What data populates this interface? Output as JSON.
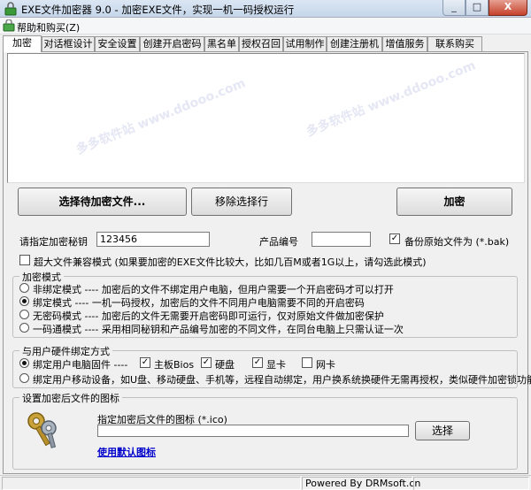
{
  "window": {
    "title": "EXE文件加密器 9.0 - 加密EXE文件，实现一机一码授权运行",
    "minimize": "_",
    "maximize": "□",
    "close": "X"
  },
  "menu": {
    "help_purchase": "帮助和购买(Z)"
  },
  "tabs": [
    "加密",
    "对话框设计",
    "安全设置",
    "创建开启密码",
    "黑名单",
    "授权召回",
    "试用制作",
    "创建注册机",
    "增值服务",
    "联系购买"
  ],
  "watermark": "多多软件站 www.ddooo.com",
  "buttons": {
    "select_files": "选择待加密文件...",
    "remove_selected": "移除选择行",
    "encrypt": "加密",
    "browse_icon": "选择"
  },
  "form": {
    "secret_key_label": "请指定加密秘钥",
    "secret_key_value": "123456",
    "product_code_label": "产品编号",
    "product_code_value": "",
    "backup_label": "备份原始文件为 (*.bak)",
    "backup_checked": true,
    "large_file_label": "超大文件兼容模式 (如果要加密的EXE文件比较大，比如几百M或者1G以上，请勾选此模式)",
    "large_file_checked": false
  },
  "encryption_mode": {
    "title": "加密模式",
    "options": [
      {
        "label": "非绑定模式 ---- 加密后的文件不绑定用户电脑，但用户需要一个开启密码才可以打开",
        "selected": false
      },
      {
        "label": "绑定模式 ---- 一机一码授权，加密后的文件不同用户电脑需要不同的开启密码",
        "selected": true
      },
      {
        "label": "无密码模式 ---- 加密后的文件无需要开启密码即可运行，仅对原始文件做加密保护",
        "selected": false
      },
      {
        "label": "一码通模式 ---- 采用相同秘钥和产品编号加密的不同文件，在同台电脑上只需认证一次",
        "selected": false
      }
    ]
  },
  "hardware_binding": {
    "title": "与用户硬件绑定方式",
    "pc_firmware_label": "绑定用户电脑固件 ----",
    "pc_firmware_selected": true,
    "components": [
      {
        "label": "主板Bios",
        "checked": true
      },
      {
        "label": "硬盘",
        "checked": true
      },
      {
        "label": "显卡",
        "checked": true
      },
      {
        "label": "网卡",
        "checked": false
      }
    ],
    "mobile_label": "绑定用户移动设备，如U盘、移动硬盘、手机等，远程自动绑定，用户换系统换硬件无需再授权，类似硬件加密锁功能",
    "mobile_selected": false
  },
  "icon_section": {
    "title": "设置加密后文件的图标",
    "prompt": "指定加密后文件的图标 (*.ico)",
    "path_value": "",
    "use_default_link": "使用默认图标"
  },
  "status": {
    "powered_by": "Powered By DRMsoft.cn"
  }
}
